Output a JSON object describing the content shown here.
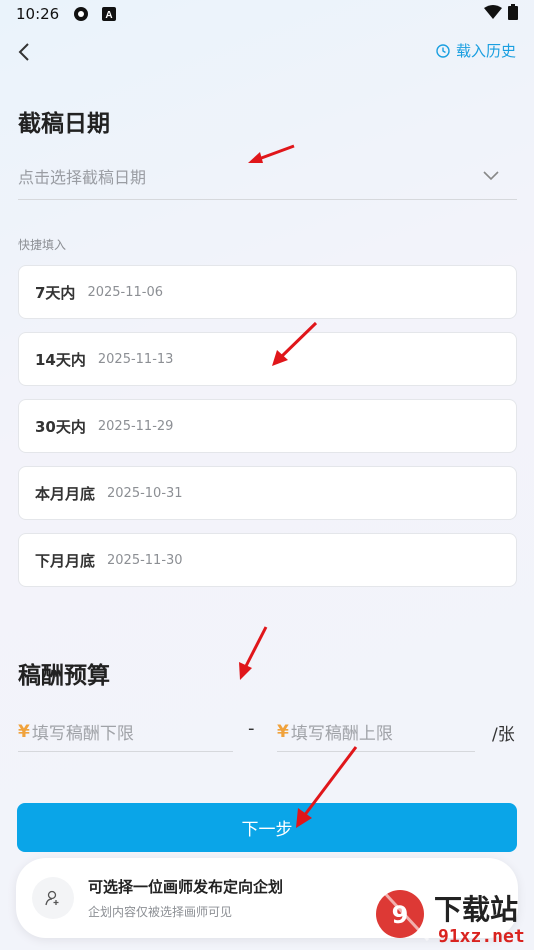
{
  "status_bar": {
    "time": "10:26"
  },
  "header": {
    "history_label": "载入历史"
  },
  "deadline": {
    "title": "截稿日期",
    "placeholder": "点击选择截稿日期",
    "quick_label": "快捷填入",
    "quick_items": [
      {
        "label": "7天内",
        "date": "2025-11-06"
      },
      {
        "label": "14天内",
        "date": "2025-11-13"
      },
      {
        "label": "30天内",
        "date": "2025-11-29"
      },
      {
        "label": "本月月底",
        "date": "2025-10-31"
      },
      {
        "label": "下月月底",
        "date": "2025-11-30"
      }
    ]
  },
  "budget": {
    "title": "稿酬预算",
    "currency": "¥",
    "min_placeholder": "填写稿酬下限",
    "max_placeholder": "填写稿酬上限",
    "separator": "-",
    "unit": "/张"
  },
  "next_button": "下一步",
  "tip": {
    "title": "可选择一位画师发布定向企划",
    "subtitle": "企划内容仅被选择画师可见"
  },
  "watermark": {
    "text": "下载站",
    "domain": "91xz.net"
  },
  "colors": {
    "accent": "#0aa5e8",
    "currency": "#f0a23b",
    "annotation_arrow": "#e0161a",
    "watermark": "#d9231f"
  }
}
